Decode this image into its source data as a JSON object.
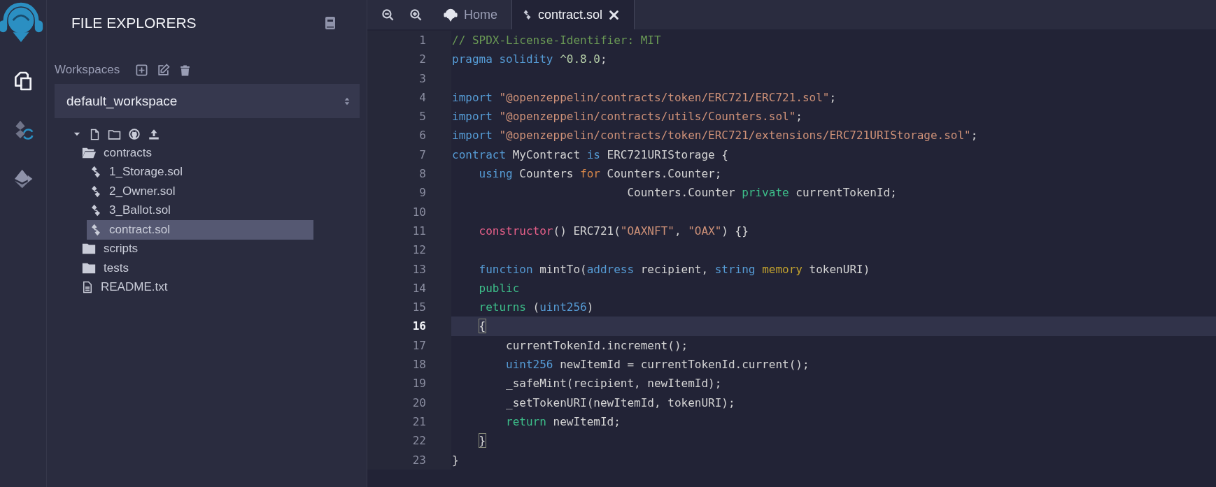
{
  "activity_bar": {
    "items": [
      {
        "kind": "files",
        "selected": true
      },
      {
        "kind": "compiler",
        "selected": false
      },
      {
        "kind": "deploy",
        "selected": false
      }
    ]
  },
  "side_panel": {
    "title": "FILE EXPLORERS",
    "workspaces_label": "Workspaces",
    "workspace_select": {
      "value": "default_workspace"
    },
    "tree": [
      {
        "name": "contracts",
        "kind": "folder",
        "expanded": true,
        "selected": false,
        "children": [
          {
            "name": "1_Storage.sol",
            "kind": "sol",
            "selected": false
          },
          {
            "name": "2_Owner.sol",
            "kind": "sol",
            "selected": false
          },
          {
            "name": "3_Ballot.sol",
            "kind": "sol",
            "selected": false
          },
          {
            "name": "contract.sol",
            "kind": "sol",
            "selected": true
          }
        ]
      },
      {
        "name": "scripts",
        "kind": "folder",
        "expanded": false,
        "selected": false
      },
      {
        "name": "tests",
        "kind": "folder",
        "expanded": false,
        "selected": false
      },
      {
        "name": "README.txt",
        "kind": "text",
        "selected": false
      }
    ]
  },
  "editor": {
    "tabs": [
      {
        "label": "Home",
        "kind": "home",
        "selected": false
      },
      {
        "label": "contract.sol",
        "kind": "sol",
        "selected": true
      }
    ],
    "lines": [
      {
        "number": "1",
        "selected": false,
        "tokens": [
          {
            "kind": "comment",
            "text": "// SPDX-License-Identifier: MIT"
          }
        ]
      },
      {
        "number": "2",
        "selected": false,
        "tokens": [
          {
            "kind": "keyword",
            "text": "pragma solidity "
          },
          {
            "kind": "number",
            "text": "^0.8.0"
          },
          {
            "kind": "plain",
            "text": ";"
          }
        ]
      },
      {
        "number": "3",
        "selected": false
      },
      {
        "number": "4",
        "selected": false,
        "tokens": [
          {
            "kind": "keyword",
            "text": "import "
          },
          {
            "kind": "string",
            "text": "\"@openzeppelin/contracts/token/ERC721/ERC721.sol\""
          },
          {
            "kind": "plain",
            "text": ";"
          }
        ]
      },
      {
        "number": "5",
        "selected": false,
        "tokens": [
          {
            "kind": "keyword",
            "text": "import "
          },
          {
            "kind": "string",
            "text": "\"@openzeppelin/contracts/utils/Counters.sol\""
          },
          {
            "kind": "plain",
            "text": ";"
          }
        ]
      },
      {
        "number": "6",
        "selected": false,
        "tokens": [
          {
            "kind": "keyword",
            "text": "import "
          },
          {
            "kind": "string",
            "text": "\"@openzeppelin/contracts/token/ERC721/extensions/ERC721URIStorage.sol\""
          },
          {
            "kind": "plain",
            "text": ";"
          }
        ]
      },
      {
        "number": "7",
        "selected": false,
        "tokens": [
          {
            "kind": "keyword",
            "text": "contract "
          },
          {
            "kind": "plain",
            "text": "MyContract "
          },
          {
            "kind": "keyword",
            "text": "is "
          },
          {
            "kind": "plain",
            "text": "ERC721URIStorage {"
          }
        ]
      },
      {
        "number": "8",
        "selected": false,
        "tokens": [
          {
            "kind": "keyword",
            "text": "    using "
          },
          {
            "kind": "plain",
            "text": "Counters "
          },
          {
            "kind": "control",
            "text": "for "
          },
          {
            "kind": "plain",
            "text": "Counters.Counter;"
          }
        ]
      },
      {
        "number": "9",
        "selected": false,
        "tokens": [
          {
            "kind": "plain",
            "text": "                          Counters.Counter "
          },
          {
            "kind": "modifier",
            "text": "private "
          },
          {
            "kind": "plain",
            "text": "currentTokenId;"
          }
        ]
      },
      {
        "number": "10",
        "selected": false
      },
      {
        "number": "11",
        "selected": false,
        "tokens": [
          {
            "kind": "special",
            "text": "    constructor"
          },
          {
            "kind": "plain",
            "text": "() ERC721("
          },
          {
            "kind": "string",
            "text": "\"OAXNFT\""
          },
          {
            "kind": "plain",
            "text": ", "
          },
          {
            "kind": "string",
            "text": "\"OAX\""
          },
          {
            "kind": "plain",
            "text": ") {}"
          }
        ]
      },
      {
        "number": "12",
        "selected": false
      },
      {
        "number": "13",
        "selected": false,
        "tokens": [
          {
            "kind": "keyword",
            "text": "    function "
          },
          {
            "kind": "plain",
            "text": "mintTo("
          },
          {
            "kind": "keyword",
            "text": "address "
          },
          {
            "kind": "plain",
            "text": "recipient, "
          },
          {
            "kind": "keyword",
            "text": "string "
          },
          {
            "kind": "storage",
            "text": "memory "
          },
          {
            "kind": "plain",
            "text": "tokenURI)"
          }
        ]
      },
      {
        "number": "14",
        "selected": false,
        "tokens": [
          {
            "kind": "modifier",
            "text": "    public"
          }
        ]
      },
      {
        "number": "15",
        "selected": false,
        "tokens": [
          {
            "kind": "modifier",
            "text": "    returns "
          },
          {
            "kind": "plain",
            "text": "("
          },
          {
            "kind": "keyword",
            "text": "uint256"
          },
          {
            "kind": "plain",
            "text": ")"
          }
        ]
      },
      {
        "number": "16",
        "selected": true,
        "tokens": [
          {
            "kind": "bracket",
            "text": "    {"
          }
        ]
      },
      {
        "number": "17",
        "selected": false,
        "tokens": [
          {
            "kind": "plain",
            "text": "        currentTokenId.increment();"
          }
        ]
      },
      {
        "number": "18",
        "selected": false,
        "tokens": [
          {
            "kind": "keyword",
            "text": "        uint256 "
          },
          {
            "kind": "plain",
            "text": "newItemId = currentTokenId.current();"
          }
        ]
      },
      {
        "number": "19",
        "selected": false,
        "tokens": [
          {
            "kind": "plain",
            "text": "        _safeMint(recipient, newItemId);"
          }
        ]
      },
      {
        "number": "20",
        "selected": false,
        "tokens": [
          {
            "kind": "plain",
            "text": "        _setTokenURI(newItemId, tokenURI);"
          }
        ]
      },
      {
        "number": "21",
        "selected": false,
        "tokens": [
          {
            "kind": "modifier",
            "text": "        return "
          },
          {
            "kind": "plain",
            "text": "newItemId;"
          }
        ]
      },
      {
        "number": "22",
        "selected": false,
        "tokens": [
          {
            "kind": "bracket",
            "text": "    }"
          }
        ]
      },
      {
        "number": "23",
        "selected": false,
        "tokens": [
          {
            "kind": "plain",
            "text": "}"
          }
        ]
      }
    ]
  }
}
